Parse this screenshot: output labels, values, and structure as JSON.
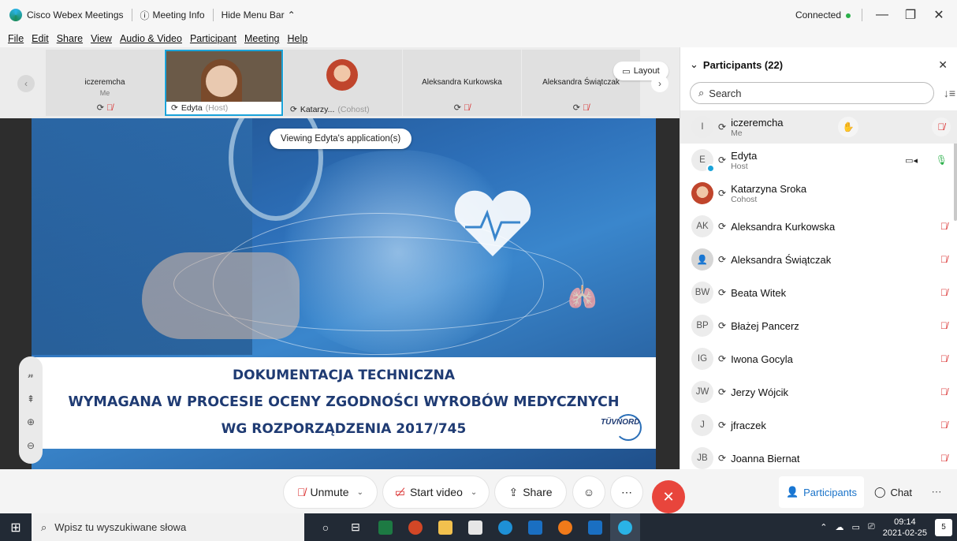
{
  "titlebar": {
    "app": "Cisco Webex Meetings",
    "meeting_info": "Meeting Info",
    "hide_menu": "Hide Menu Bar",
    "status": "Connected"
  },
  "menu": [
    "File",
    "Edit",
    "Share",
    "View",
    "Audio & Video",
    "Participant",
    "Meeting",
    "Help"
  ],
  "thumbnails": [
    {
      "name": "iczeremcha",
      "sub": "Me"
    },
    {
      "name": "Edyta",
      "role": "(Host)"
    },
    {
      "name": "Katarzy...",
      "role": "(Cohost)"
    },
    {
      "name": "Aleksandra Kurkowska"
    },
    {
      "name": "Aleksandra Świątczak"
    }
  ],
  "layout_label": "Layout",
  "viewing_banner": "Viewing Edyta's application(s)",
  "slide": {
    "line1": "DOKUMENTACJA TECHNICZNA",
    "line2": "WYMAGANA W PROCESIE OCENY ZGODNOŚCI WYROBÓW MEDYCZNYCH",
    "line3": "WG ROZPORZĄDZENIA 2017/745",
    "logo": "TÜVNORD"
  },
  "panel": {
    "title": "Participants (22)",
    "search_placeholder": "Search",
    "participants": [
      {
        "initials": "I",
        "name": "iczeremcha",
        "role": "Me"
      },
      {
        "initials": "E",
        "name": "Edyta",
        "role": "Host"
      },
      {
        "initials": "",
        "name": "Katarzyna Sroka",
        "role": "Cohost"
      },
      {
        "initials": "AK",
        "name": "Aleksandra Kurkowska",
        "role": ""
      },
      {
        "initials": "",
        "name": "Aleksandra Świątczak",
        "role": ""
      },
      {
        "initials": "BW",
        "name": "Beata Witek",
        "role": ""
      },
      {
        "initials": "BP",
        "name": "Błażej Pancerz",
        "role": ""
      },
      {
        "initials": "IG",
        "name": "Iwona Gocyla",
        "role": ""
      },
      {
        "initials": "JW",
        "name": "Jerzy Wójcik",
        "role": ""
      },
      {
        "initials": "J",
        "name": "jfraczek",
        "role": ""
      },
      {
        "initials": "JB",
        "name": "Joanna Biernat",
        "role": ""
      }
    ]
  },
  "controls": {
    "unmute": "Unmute",
    "start_video": "Start video",
    "share": "Share",
    "participants": "Participants",
    "chat": "Chat"
  },
  "taskbar": {
    "search_placeholder": "Wpisz tu wyszukiwane słowa",
    "time": "09:14",
    "date": "2021-02-25",
    "notifications": "5"
  },
  "colors": {
    "accent": "#1aa3d9",
    "mute_red": "#d92b2b",
    "leave_red": "#e8453c",
    "slide_text": "#1f3b73",
    "connected_green": "#2bb04a"
  }
}
